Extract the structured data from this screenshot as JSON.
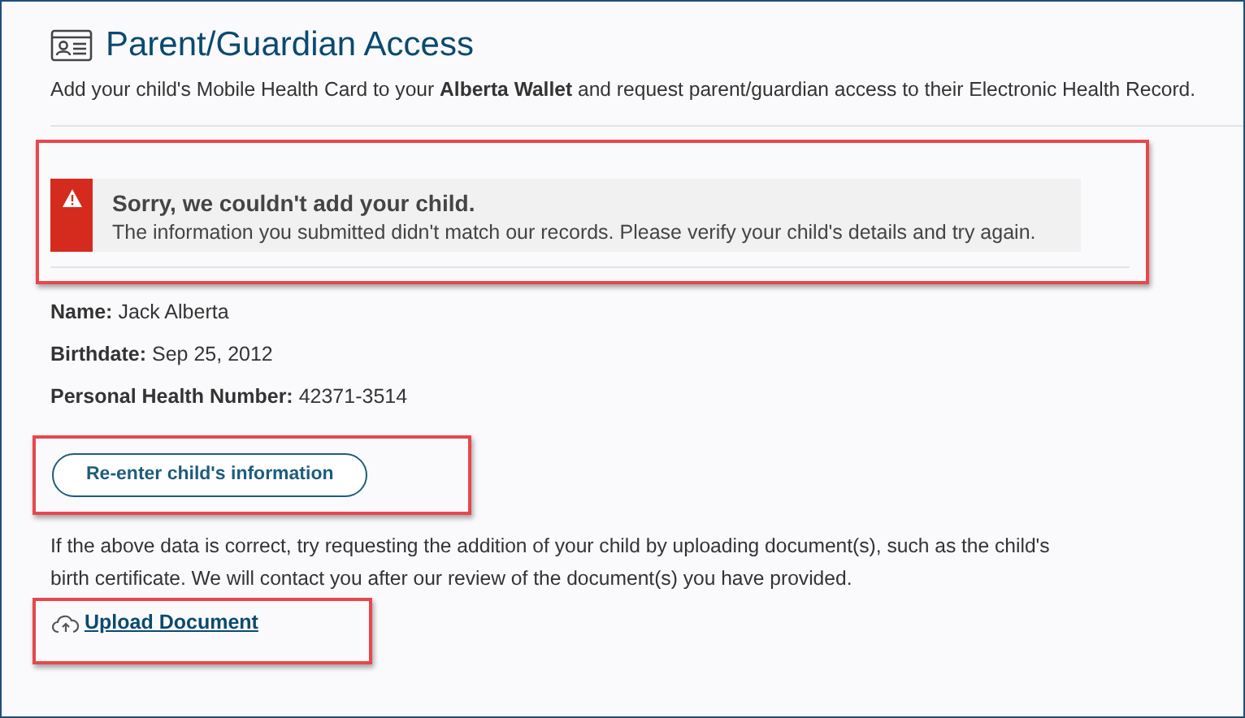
{
  "header": {
    "title": "Parent/Guardian Access",
    "description": "Add your child's Mobile Health Card to your **Alberta Wallet** and request parent/guardian access to their Electronic Health Record."
  },
  "alert": {
    "kind": "error",
    "highlighted": true,
    "heading": "Sorry, we couldn't add your child.",
    "message": "The information you submitted didn't match our records. Please verify your child's details and try again."
  },
  "details": [
    {
      "label": "Name:",
      "value": "Jack Alberta"
    },
    {
      "label": "Birthdate:",
      "value": "Sep 25, 2012"
    },
    {
      "label": "Personal Health Number:",
      "value": "42371-3514"
    }
  ],
  "reenter_button": {
    "label": "Re-enter child's information",
    "highlighted": true
  },
  "upload_note": "If the above data is correct, try requesting the addition of your child by uploading document(s), such as the child's birth certificate. We will contact you after our review of the document(s) you have provided.",
  "upload_link": {
    "label": "Upload Document",
    "highlighted": true
  }
}
